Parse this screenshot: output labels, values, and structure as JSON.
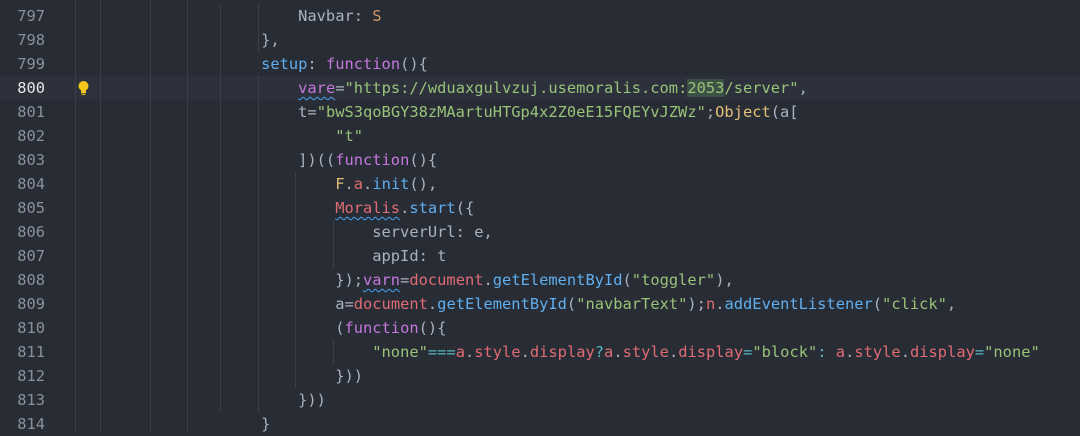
{
  "editor": {
    "active_line": "800",
    "lines": [
      {
        "no": "797",
        "tokens": [
          {
            "t": "        Navbar",
            "c": "p"
          },
          {
            "t": ":",
            "c": "p"
          },
          {
            "t": " S",
            "c": "c"
          }
        ]
      },
      {
        "no": "798",
        "tokens": [
          {
            "t": "    },",
            "c": "p"
          }
        ]
      },
      {
        "no": "799",
        "tokens": [
          {
            "t": "    setup",
            "c": "f"
          },
          {
            "t": ": ",
            "c": "p"
          },
          {
            "t": "function",
            "c": "k"
          },
          {
            "t": "(){",
            "c": "p"
          }
        ]
      },
      {
        "no": "800",
        "tokens": [
          {
            "t": "        ",
            "c": "p"
          },
          {
            "t": "vare",
            "c": "k",
            "squig": true
          },
          {
            "t": "=",
            "c": "p"
          },
          {
            "t": "\"https://wduaxgulvzuj.usemoralis.com:",
            "c": "s"
          },
          {
            "t": "2053",
            "c": "s",
            "hl": true
          },
          {
            "t": "/server\"",
            "c": "s"
          },
          {
            "t": ",",
            "c": "p"
          }
        ]
      },
      {
        "no": "801",
        "tokens": [
          {
            "t": "        t",
            "c": "p"
          },
          {
            "t": "=",
            "c": "p"
          },
          {
            "t": "\"bwS3qoBGY38zMAartuHTGp4x2Z0eE15FQEYvJZWz\"",
            "c": "s"
          },
          {
            "t": ";",
            "c": "p"
          },
          {
            "t": "Object",
            "c": "pl"
          },
          {
            "t": "(a[",
            "c": "p"
          }
        ]
      },
      {
        "no": "802",
        "tokens": [
          {
            "t": "            ",
            "c": "p"
          },
          {
            "t": "\"t\"",
            "c": "s"
          }
        ]
      },
      {
        "no": "803",
        "tokens": [
          {
            "t": "        ])((",
            "c": "p"
          },
          {
            "t": "function",
            "c": "k"
          },
          {
            "t": "(){",
            "c": "p"
          }
        ]
      },
      {
        "no": "804",
        "tokens": [
          {
            "t": "            ",
            "c": "p"
          },
          {
            "t": "F",
            "c": "pl"
          },
          {
            "t": ".",
            "c": "p"
          },
          {
            "t": "a",
            "c": "v"
          },
          {
            "t": ".",
            "c": "p"
          },
          {
            "t": "init",
            "c": "f"
          },
          {
            "t": "(),",
            "c": "p"
          }
        ]
      },
      {
        "no": "805",
        "tokens": [
          {
            "t": "            ",
            "c": "p"
          },
          {
            "t": "Moralis",
            "c": "v",
            "squig": true
          },
          {
            "t": ".",
            "c": "p"
          },
          {
            "t": "start",
            "c": "f"
          },
          {
            "t": "({",
            "c": "p"
          }
        ]
      },
      {
        "no": "806",
        "tokens": [
          {
            "t": "                serverUrl",
            "c": "p"
          },
          {
            "t": ":",
            "c": "p"
          },
          {
            "t": " e,",
            "c": "p"
          }
        ]
      },
      {
        "no": "807",
        "tokens": [
          {
            "t": "                appId",
            "c": "p"
          },
          {
            "t": ":",
            "c": "p"
          },
          {
            "t": " t",
            "c": "p"
          }
        ]
      },
      {
        "no": "808",
        "tokens": [
          {
            "t": "            });",
            "c": "p"
          },
          {
            "t": "varn",
            "c": "k",
            "squig": true
          },
          {
            "t": "=",
            "c": "p"
          },
          {
            "t": "document",
            "c": "v"
          },
          {
            "t": ".",
            "c": "p"
          },
          {
            "t": "getElementById",
            "c": "f"
          },
          {
            "t": "(",
            "c": "p"
          },
          {
            "t": "\"toggler\"",
            "c": "s"
          },
          {
            "t": "),",
            "c": "p"
          }
        ]
      },
      {
        "no": "809",
        "tokens": [
          {
            "t": "            a",
            "c": "p"
          },
          {
            "t": "=",
            "c": "p"
          },
          {
            "t": "document",
            "c": "v"
          },
          {
            "t": ".",
            "c": "p"
          },
          {
            "t": "getElementById",
            "c": "f"
          },
          {
            "t": "(",
            "c": "p"
          },
          {
            "t": "\"navbarText\"",
            "c": "s"
          },
          {
            "t": ");",
            "c": "p"
          },
          {
            "t": "n",
            "c": "v"
          },
          {
            "t": ".",
            "c": "p"
          },
          {
            "t": "addEventListener",
            "c": "f"
          },
          {
            "t": "(",
            "c": "p"
          },
          {
            "t": "\"click\"",
            "c": "s"
          },
          {
            "t": ",",
            "c": "p"
          }
        ]
      },
      {
        "no": "810",
        "tokens": [
          {
            "t": "            (",
            "c": "p"
          },
          {
            "t": "function",
            "c": "k"
          },
          {
            "t": "(){",
            "c": "p"
          }
        ]
      },
      {
        "no": "811",
        "tokens": [
          {
            "t": "                ",
            "c": "p"
          },
          {
            "t": "\"none\"",
            "c": "s"
          },
          {
            "t": "===",
            "c": "o"
          },
          {
            "t": "a",
            "c": "v"
          },
          {
            "t": ".",
            "c": "p"
          },
          {
            "t": "style",
            "c": "v"
          },
          {
            "t": ".",
            "c": "p"
          },
          {
            "t": "display",
            "c": "v"
          },
          {
            "t": "?",
            "c": "o"
          },
          {
            "t": "a",
            "c": "v"
          },
          {
            "t": ".",
            "c": "p"
          },
          {
            "t": "style",
            "c": "v"
          },
          {
            "t": ".",
            "c": "p"
          },
          {
            "t": "display",
            "c": "v"
          },
          {
            "t": "=",
            "c": "o"
          },
          {
            "t": "\"block\"",
            "c": "s"
          },
          {
            "t": ": ",
            "c": "o"
          },
          {
            "t": "a",
            "c": "v"
          },
          {
            "t": ".",
            "c": "p"
          },
          {
            "t": "style",
            "c": "v"
          },
          {
            "t": ".",
            "c": "p"
          },
          {
            "t": "display",
            "c": "v"
          },
          {
            "t": "=",
            "c": "o"
          },
          {
            "t": "\"none\"",
            "c": "s"
          }
        ]
      },
      {
        "no": "812",
        "tokens": [
          {
            "t": "            }))",
            "c": "p"
          }
        ]
      },
      {
        "no": "813",
        "tokens": [
          {
            "t": "        }))",
            "c": "p"
          }
        ]
      },
      {
        "no": "814",
        "tokens": [
          {
            "t": "    }",
            "c": "p"
          }
        ]
      }
    ]
  },
  "colors": {
    "background": "#282c34",
    "active_line": "#2c313c",
    "keyword": "#c678dd",
    "string": "#98c379",
    "variable": "#e06c75",
    "function": "#61afef",
    "operator": "#56b6c2",
    "squiggle": "#4aa3f0",
    "lightbulb": "#f5c518"
  },
  "gutter": {
    "lightbulb_icon": "lightbulb-icon",
    "lightbulb_line": "800"
  }
}
